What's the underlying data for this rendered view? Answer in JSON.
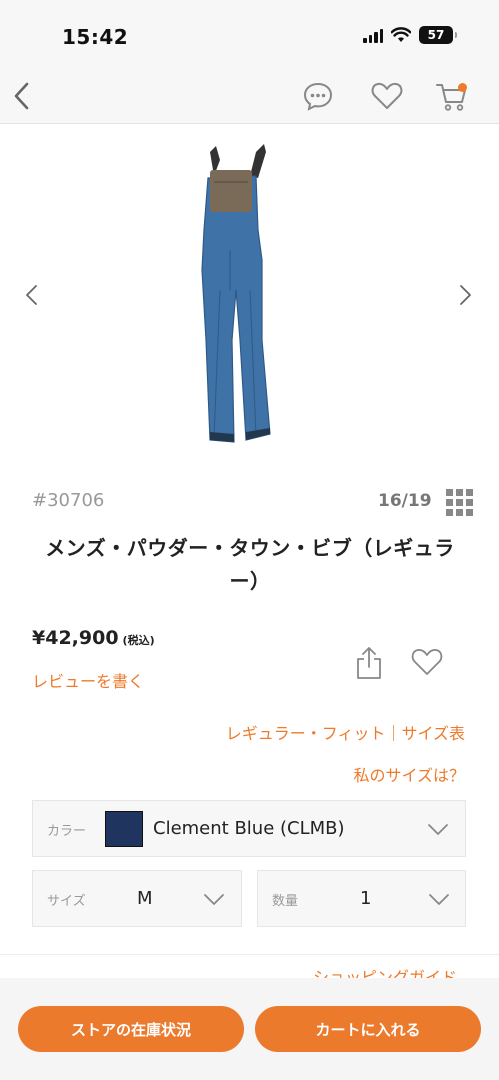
{
  "status_bar": {
    "time": "15:42",
    "battery": "57"
  },
  "nav": {
    "back_icon": "chevron-left-icon",
    "chat_icon": "chat-bubble-icon",
    "favorite_icon": "heart-icon",
    "cart_icon": "cart-icon"
  },
  "carousel": {
    "product_image": "blue-snow-bib-overalls",
    "prev_icon": "chevron-left-icon",
    "next_icon": "chevron-right-icon"
  },
  "product": {
    "style_number": "#30706",
    "image_counter": "16/19",
    "name": "メンズ・パウダー・タウン・ビブ（レギュラー）",
    "price": "¥42,900",
    "price_tax": "(税込)",
    "review_link": "レビューを書く",
    "fit_link": "レギュラー・フィット｜サイズ表",
    "my_size_link": "私のサイズは？"
  },
  "options": {
    "color_label": "カラー",
    "color_value": "Clement Blue (CLMB)",
    "color_swatch": "#1f3560",
    "size_label": "サイズ",
    "size_value": "M",
    "qty_label": "数量",
    "qty_value": "1"
  },
  "shopping_guide": "ショッピングガイド",
  "buttons": {
    "store_stock": "ストアの在庫状況",
    "add_to_cart": "カートに入れる"
  },
  "colors": {
    "accent": "#ee7a2a"
  }
}
